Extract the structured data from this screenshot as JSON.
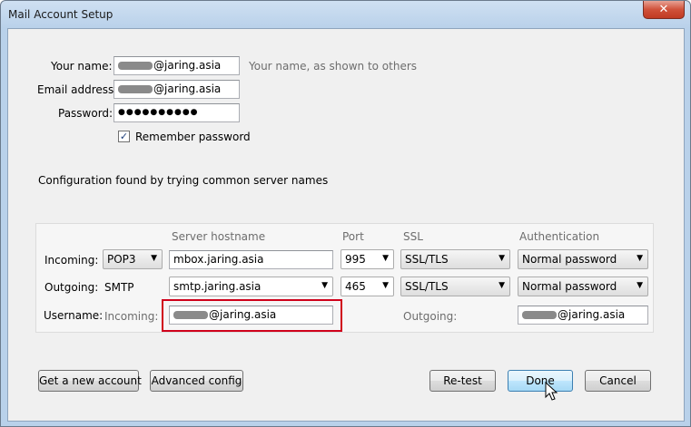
{
  "window": {
    "title": "Mail Account Setup",
    "close_glyph": "✕"
  },
  "form": {
    "name_label": "Your name:",
    "name_value": "@jaring.asia",
    "name_hint": "Your name, as shown to others",
    "email_label": "Email address:",
    "email_value": "@jaring.asia",
    "password_label": "Password:",
    "password_value": "●●●●●●●●●●",
    "remember_label": "Remember password",
    "remember_checked": true,
    "check_glyph": "✓"
  },
  "status_message": "Configuration found by trying common server names",
  "config": {
    "headers": {
      "hostname": "Server hostname",
      "port": "Port",
      "ssl": "SSL",
      "auth": "Authentication"
    },
    "incoming": {
      "label": "Incoming:",
      "protocol": "POP3",
      "hostname": "mbox.jaring.asia",
      "port": "995",
      "ssl": "SSL/TLS",
      "auth": "Normal password"
    },
    "outgoing": {
      "label": "Outgoing:",
      "protocol": "SMTP",
      "hostname": "smtp.jaring.asia",
      "port": "465",
      "ssl": "SSL/TLS",
      "auth": "Normal password"
    },
    "username": {
      "label": "Username:",
      "incoming_label": "Incoming:",
      "incoming_value": "@jaring.asia",
      "outgoing_label": "Outgoing:",
      "outgoing_value": "@jaring.asia"
    }
  },
  "buttons": {
    "get_new_account": "Get a new account",
    "advanced_config": "Advanced config",
    "retest": "Re-test",
    "done": "Done",
    "cancel": "Cancel"
  },
  "dropdown_arrow": "▼",
  "colors": {
    "highlight": "#d0021b",
    "title_bar": "#b9d1ea",
    "close_button": "#c03a22"
  }
}
